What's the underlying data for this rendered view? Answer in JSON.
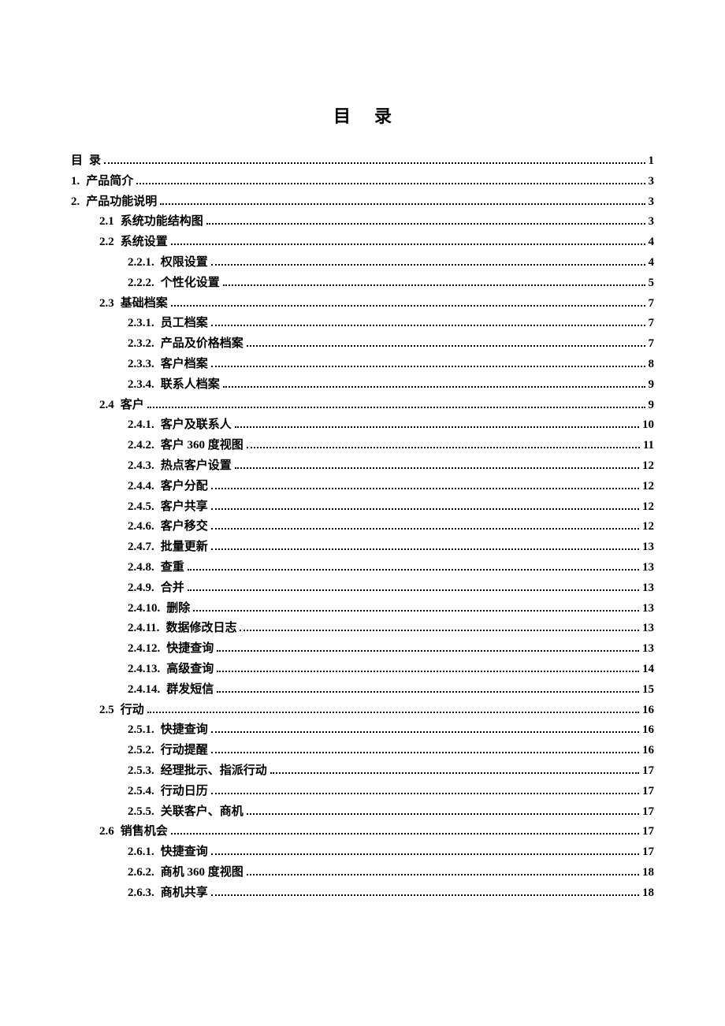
{
  "title": "目录",
  "entries": [
    {
      "level": 0,
      "label": "目",
      "text": "录",
      "page": "1"
    },
    {
      "level": 0,
      "label": "1.",
      "text": "产品简介",
      "page": "3"
    },
    {
      "level": 0,
      "label": "2.",
      "text": "产品功能说明",
      "page": "3"
    },
    {
      "level": 1,
      "label": "2.1",
      "text": "系统功能结构图",
      "page": "3"
    },
    {
      "level": 1,
      "label": "2.2",
      "text": "系统设置",
      "page": "4"
    },
    {
      "level": 2,
      "label": "2.2.1.",
      "text": "权限设置",
      "page": "4"
    },
    {
      "level": 2,
      "label": "2.2.2.",
      "text": "个性化设置",
      "page": "5"
    },
    {
      "level": 1,
      "label": "2.3",
      "text": "基础档案",
      "page": "7"
    },
    {
      "level": 2,
      "label": "2.3.1.",
      "text": "员工档案",
      "page": "7"
    },
    {
      "level": 2,
      "label": "2.3.2.",
      "text": "产品及价格档案",
      "page": "7"
    },
    {
      "level": 2,
      "label": "2.3.3.",
      "text": "客户档案",
      "page": "8"
    },
    {
      "level": 2,
      "label": "2.3.4.",
      "text": "联系人档案",
      "page": "9"
    },
    {
      "level": 1,
      "label": "2.4",
      "text": "客户",
      "page": "9"
    },
    {
      "level": 2,
      "label": "2.4.1.",
      "text": "客户及联系人",
      "page": "10"
    },
    {
      "level": 2,
      "label": "2.4.2.",
      "text": "客户 360 度视图",
      "page": "11"
    },
    {
      "level": 2,
      "label": "2.4.3.",
      "text": "热点客户设置",
      "page": "12"
    },
    {
      "level": 2,
      "label": "2.4.4.",
      "text": "客户分配",
      "page": "12"
    },
    {
      "level": 2,
      "label": "2.4.5.",
      "text": "客户共享",
      "page": "12"
    },
    {
      "level": 2,
      "label": "2.4.6.",
      "text": "客户移交",
      "page": "12"
    },
    {
      "level": 2,
      "label": "2.4.7.",
      "text": "批量更新",
      "page": "13"
    },
    {
      "level": 2,
      "label": "2.4.8.",
      "text": "查重",
      "page": "13"
    },
    {
      "level": 2,
      "label": "2.4.9.",
      "text": "合并",
      "page": "13"
    },
    {
      "level": 2,
      "label": "2.4.10.",
      "text": "删除",
      "page": "13"
    },
    {
      "level": 2,
      "label": "2.4.11.",
      "text": "数据修改日志",
      "page": "13"
    },
    {
      "level": 2,
      "label": "2.4.12.",
      "text": "快捷查询",
      "page": "13"
    },
    {
      "level": 2,
      "label": "2.4.13.",
      "text": "高级查询",
      "page": "14"
    },
    {
      "level": 2,
      "label": "2.4.14.",
      "text": "群发短信",
      "page": "15"
    },
    {
      "level": 1,
      "label": "2.5",
      "text": "行动",
      "page": "16"
    },
    {
      "level": 2,
      "label": "2.5.1.",
      "text": "快捷查询",
      "page": "16"
    },
    {
      "level": 2,
      "label": "2.5.2.",
      "text": "行动提醒",
      "page": "16"
    },
    {
      "level": 2,
      "label": "2.5.3.",
      "text": "经理批示、指派行动",
      "page": "17"
    },
    {
      "level": 2,
      "label": "2.5.4.",
      "text": "行动日历",
      "page": "17"
    },
    {
      "level": 2,
      "label": "2.5.5.",
      "text": "关联客户、商机",
      "page": "17"
    },
    {
      "level": 1,
      "label": "2.6",
      "text": "销售机会",
      "page": "17"
    },
    {
      "level": 2,
      "label": "2.6.1.",
      "text": "快捷查询",
      "page": "17"
    },
    {
      "level": 2,
      "label": "2.6.2.",
      "text": "商机 360 度视图",
      "page": "18"
    },
    {
      "level": 2,
      "label": "2.6.3.",
      "text": "商机共享",
      "page": "18"
    }
  ]
}
